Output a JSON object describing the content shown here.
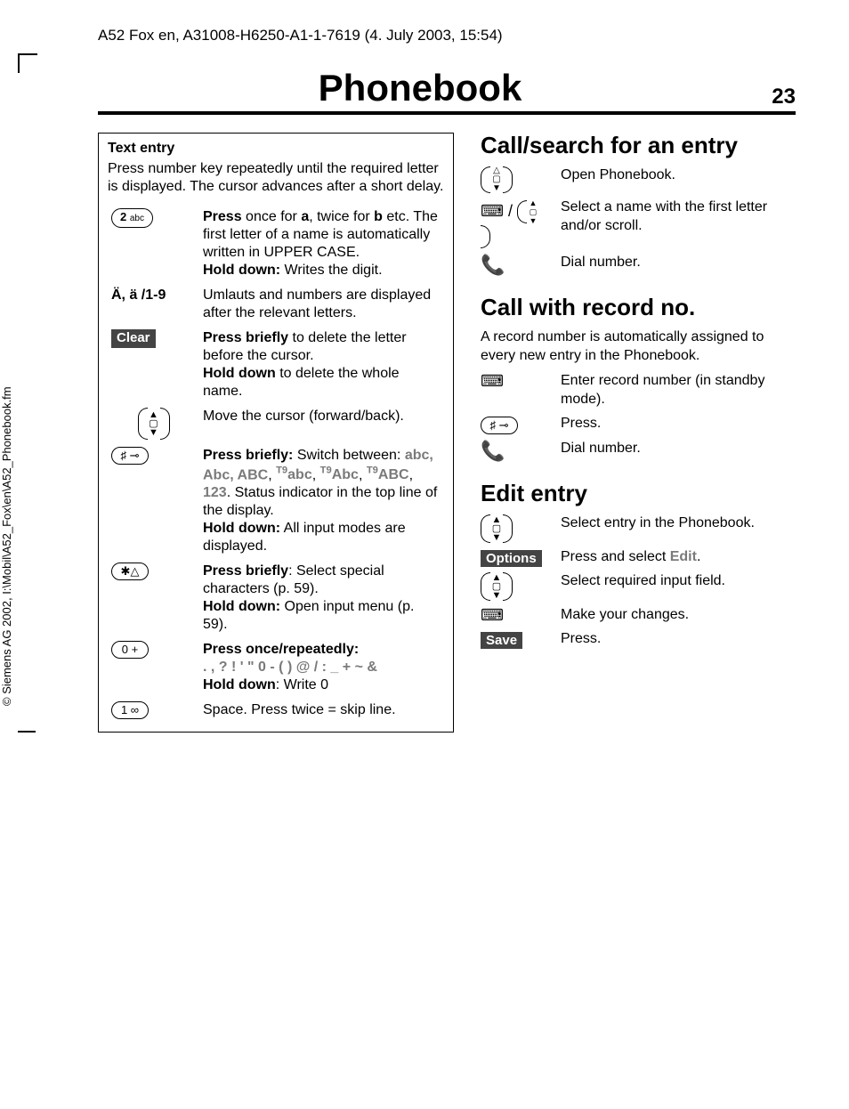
{
  "header": {
    "meta": "A52 Fox en, A31008-H6250-A1-1-7619 (4. July 2003, 15:54)",
    "title": "Phonebook",
    "page": "23"
  },
  "left": {
    "heading": "Text entry",
    "intro": "Press number key repeatedly until the required letter is displayed. The cursor advances after a short delay.",
    "rows": [
      {
        "b1": "Press",
        "t1": "once for",
        "b2": "a",
        "t2": ", twice for",
        "b3": "b",
        "t3": "etc. The first letter of a name is automatically written in UPPER CASE.",
        "b4": "Hold down:",
        "t4": "Writes the digit."
      },
      {
        "key": "Ä, ä /1-9",
        "text": "Umlauts and numbers are displayed after the relevant letters."
      },
      {
        "key": "Clear",
        "b1": "Press briefly",
        "t1": "to delete the letter before the cursor.",
        "b2": "Hold down",
        "t2": "to delete the whole name."
      },
      {
        "text": "Move the cursor (forward/back)."
      },
      {
        "b1": "Press briefly:",
        "t1": "Switch between:",
        "modes1": "abc, Abc, ABC",
        "c": ",",
        "m2": "abc",
        "m3": "Abc",
        "m4": "ABC",
        "m5": "123",
        "t2": ". Status indicator in the top line of the display.",
        "b2": "Hold down:",
        "t3": "All input modes are displayed."
      },
      {
        "b1": "Press briefly",
        "t1": ": Select special characters (p. 59).",
        "b2": "Hold down:",
        "t2": "Open input menu (p. 59)."
      },
      {
        "b1": "Press once/repeatedly:",
        "chars": ". , ? ! ' \" 0 - ( ) @ / : _ + ~ &",
        "b2": "Hold down",
        "t2": ": Write 0"
      },
      {
        "text": "Space. Press twice = skip line."
      }
    ]
  },
  "right": {
    "s1": {
      "h": "Call/search for an entry",
      "steps": [
        "Open Phonebook.",
        "Select a name with the first letter and/or scroll.",
        "Dial number."
      ]
    },
    "s2": {
      "h": "Call with record no.",
      "intro": "A record number is automatically assigned to every new entry in the Phonebook.",
      "steps": [
        "Enter record number (in standby mode).",
        "Press.",
        "Dial number."
      ]
    },
    "s3": {
      "h": "Edit entry",
      "k_options": "Options",
      "k_save": "Save",
      "edit": "Edit",
      "steps": [
        "Select entry in the Phonebook.",
        "",
        "Select required input field.",
        "Make your changes.",
        "Press."
      ],
      "steps.1a": "Press and select",
      "steps1a": "Press and select",
      "steps1b": ".",
      "steps.1b": "."
    }
  },
  "footer": {
    "copyright": "© Siemens AG 2002, I:\\Mobil\\A52_Fox\\en\\A52_Phonebook.fm"
  }
}
